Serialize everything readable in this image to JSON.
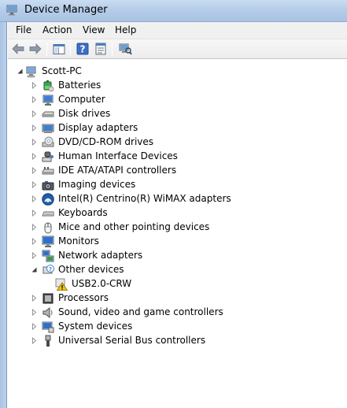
{
  "window": {
    "title": "Device Manager"
  },
  "menu": {
    "items": [
      "File",
      "Action",
      "View",
      "Help"
    ]
  },
  "toolbar": {
    "buttons": [
      "back-icon",
      "forward-icon",
      "show-hide-console-tree-icon",
      "help-icon",
      "properties-icon",
      "scan-hardware-icon"
    ]
  },
  "tree": {
    "root": "Scott-PC",
    "categories": [
      "Batteries",
      "Computer",
      "Disk drives",
      "Display adapters",
      "DVD/CD-ROM drives",
      "Human Interface Devices",
      "IDE ATA/ATAPI controllers",
      "Imaging devices",
      "Intel(R) Centrino(R) WiMAX adapters",
      "Keyboards",
      "Mice and other pointing devices",
      "Monitors",
      "Network adapters",
      "Other devices",
      "Processors",
      "Sound, video and game controllers",
      "System devices",
      "Universal Serial Bus controllers"
    ],
    "other_devices_children": [
      "USB2.0-CRW"
    ]
  },
  "colors": {
    "titlebar": "#b5cde9",
    "warning": "#f5c400"
  }
}
